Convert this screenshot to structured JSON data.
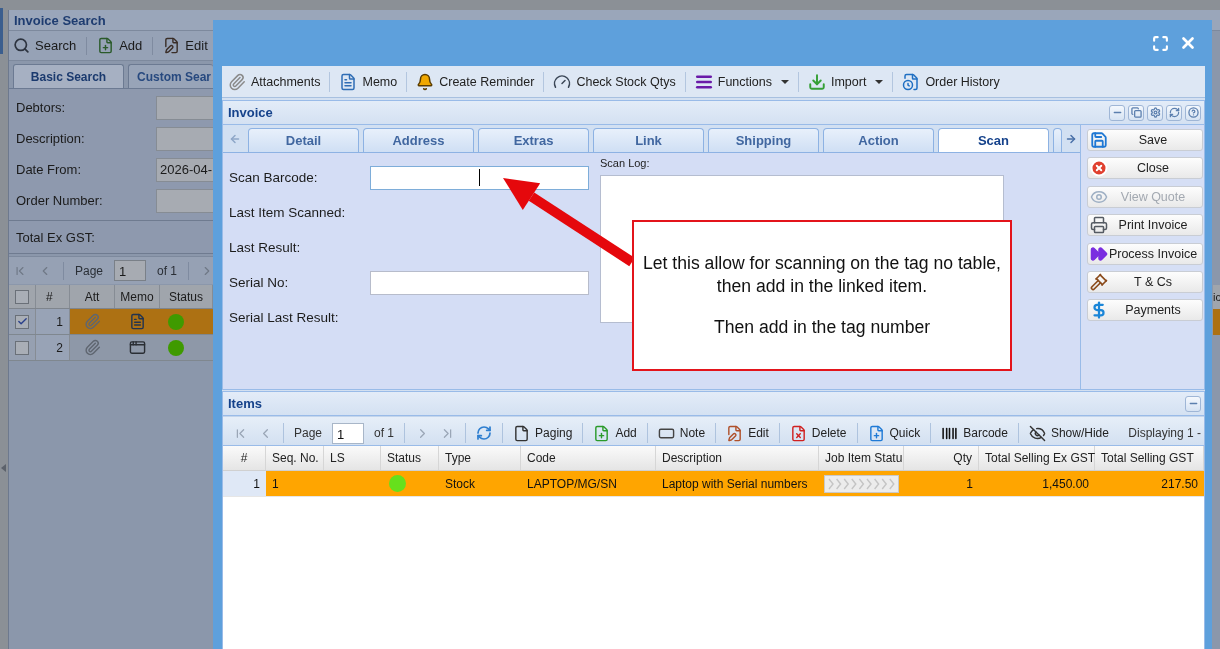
{
  "background_page": {
    "title": "Invoice Search",
    "toolbar": [
      {
        "label": "Search"
      },
      {
        "label": "Add"
      },
      {
        "label": "Edit"
      }
    ],
    "tabs": [
      {
        "label": "Basic Search",
        "selected": true
      },
      {
        "label": "Custom Sear",
        "selected": false
      }
    ],
    "fields": [
      {
        "label": "Debtors:"
      },
      {
        "label": "Description:"
      },
      {
        "label": "Date From:",
        "value": "2026-04-"
      },
      {
        "label": "Order Number:"
      }
    ],
    "total_label": "Total Ex GST:",
    "pager": {
      "page_label": "Page",
      "page": "1",
      "of_pages": "of 1"
    },
    "grid": {
      "select_all_checked": false,
      "columns": [
        "#",
        "Att",
        "Memo",
        "Status"
      ],
      "rows": [
        {
          "number": "1",
          "checked": true,
          "selected": true,
          "has_memo": true,
          "color": "#3f9a00"
        },
        {
          "number": "2",
          "checked": false,
          "selected": false,
          "has_memo": false,
          "color": "#3f9a00"
        }
      ]
    },
    "edge_column_header": "ic"
  },
  "modal": {
    "toolbar": [
      {
        "label": "Attachments",
        "menu": false
      },
      {
        "label": "Memo",
        "menu": false
      },
      {
        "label": "Create Reminder",
        "menu": false
      },
      {
        "label": "Check Stock Qtys",
        "menu": false
      },
      {
        "label": "Functions",
        "menu": true
      },
      {
        "label": "Import",
        "menu": true
      },
      {
        "label": "Order History",
        "menu": false
      }
    ],
    "invoice": {
      "title": "Invoice",
      "tabs": [
        {
          "label": "Detail",
          "selected": false
        },
        {
          "label": "Address",
          "selected": false
        },
        {
          "label": "Extras",
          "selected": false
        },
        {
          "label": "Link",
          "selected": false
        },
        {
          "label": "Shipping",
          "selected": false
        },
        {
          "label": "Action",
          "selected": false
        },
        {
          "label": "Scan",
          "selected": true
        }
      ],
      "fields": [
        {
          "label": "Scan Barcode:",
          "kind": "input",
          "focused": true
        },
        {
          "label": "Last Item Scanned:",
          "kind": "readout"
        },
        {
          "label": "Last Result:",
          "kind": "readout"
        },
        {
          "label": "Serial No:",
          "kind": "input",
          "focused": false
        },
        {
          "label": "Serial Last Result:",
          "kind": "readout"
        }
      ],
      "scan_log_label": "Scan Log:",
      "actions": [
        {
          "label": "Save",
          "disabled": false
        },
        {
          "label": "Close",
          "disabled": false
        },
        {
          "label": "View Quote",
          "disabled": true
        },
        {
          "label": "Print Invoice",
          "disabled": false
        },
        {
          "label": "Process Invoice",
          "disabled": false
        },
        {
          "label": "T & Cs",
          "disabled": false
        },
        {
          "label": "Payments",
          "disabled": false
        }
      ]
    },
    "items": {
      "title": "Items",
      "pager": {
        "page_label": "Page",
        "page": "1",
        "of_pages": "of 1"
      },
      "toolbar": [
        {
          "label": "Paging"
        },
        {
          "label": "Add"
        },
        {
          "label": "Note"
        },
        {
          "label": "Edit"
        },
        {
          "label": "Delete"
        },
        {
          "label": "Quick"
        },
        {
          "label": "Barcode"
        },
        {
          "label": "Show/Hide"
        }
      ],
      "displaying": "Displaying 1 -",
      "columns": [
        "#",
        "Seq. No.",
        "LS",
        "Status",
        "Type",
        "Code",
        "Description",
        "Job Item Statu",
        "Qty",
        "Total Selling Ex GST",
        "Total Selling GST"
      ],
      "rows": [
        {
          "selected": true,
          "number": "1",
          "seq_no": "1",
          "color": "#66e01c",
          "type": "Stock",
          "code": "LAPTOP/MG/SN",
          "description": "Laptop with Serial numbers",
          "qty": "1",
          "total_ex_gst": "1,450.00",
          "total_gst": "217.50"
        }
      ]
    }
  },
  "annotation": {
    "paragraphs": [
      "Let this allow for scanning on the tag no table, then add in the linked item.",
      "Then add in the tag number"
    ],
    "arrow": true
  }
}
